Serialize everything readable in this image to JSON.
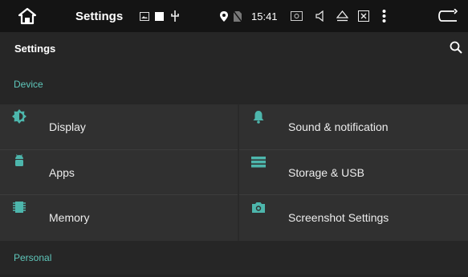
{
  "status_bar": {
    "title": "Settings",
    "time": "15:41",
    "icons": [
      "home-icon",
      "image-icon",
      "square-icon",
      "usb-icon",
      "location-icon",
      "no-sim-icon",
      "screenshot-icon",
      "volume-icon",
      "eject-icon",
      "close-box-icon",
      "more-vert-icon",
      "back-icon"
    ]
  },
  "toolbar": {
    "title": "Settings",
    "search_icon": "search-icon"
  },
  "sections": {
    "device": {
      "label": "Device"
    },
    "personal": {
      "label": "Personal"
    }
  },
  "items": {
    "display": {
      "label": "Display",
      "icon": "brightness-icon"
    },
    "sound": {
      "label": "Sound & notification",
      "icon": "bell-icon"
    },
    "apps": {
      "label": "Apps",
      "icon": "android-icon"
    },
    "storage": {
      "label": "Storage & USB",
      "icon": "storage-icon"
    },
    "memory": {
      "label": "Memory",
      "icon": "memory-chip-icon"
    },
    "screenshot": {
      "label": "Screenshot Settings",
      "icon": "camera-icon"
    }
  },
  "colors": {
    "accent": "#5fc7bb",
    "icon_teal": "#4db6ac",
    "background": "#303030"
  }
}
